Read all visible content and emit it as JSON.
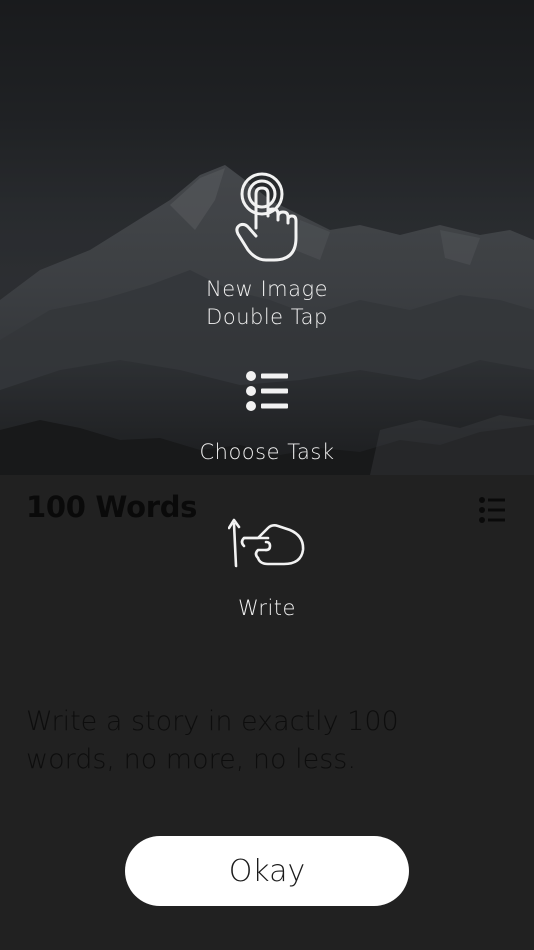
{
  "hints": {
    "new_image_line1": "New Image",
    "new_image_line2": "Double Tap",
    "choose_task": "Choose Task",
    "write": "Write"
  },
  "task": {
    "title": "100 Words",
    "prompt": "Write a story in exactly 100 words, no more, no less."
  },
  "okay_label": "Okay",
  "icons": {
    "double_tap": "double-tap-hand-icon",
    "choose_task": "list-icon",
    "write": "swipe-up-hand-icon",
    "task_list": "list-icon"
  },
  "colors": {
    "background": "#282828",
    "title_text": "#060606",
    "hint_text": "#f0f0f0",
    "button_bg": "#ffffff"
  }
}
